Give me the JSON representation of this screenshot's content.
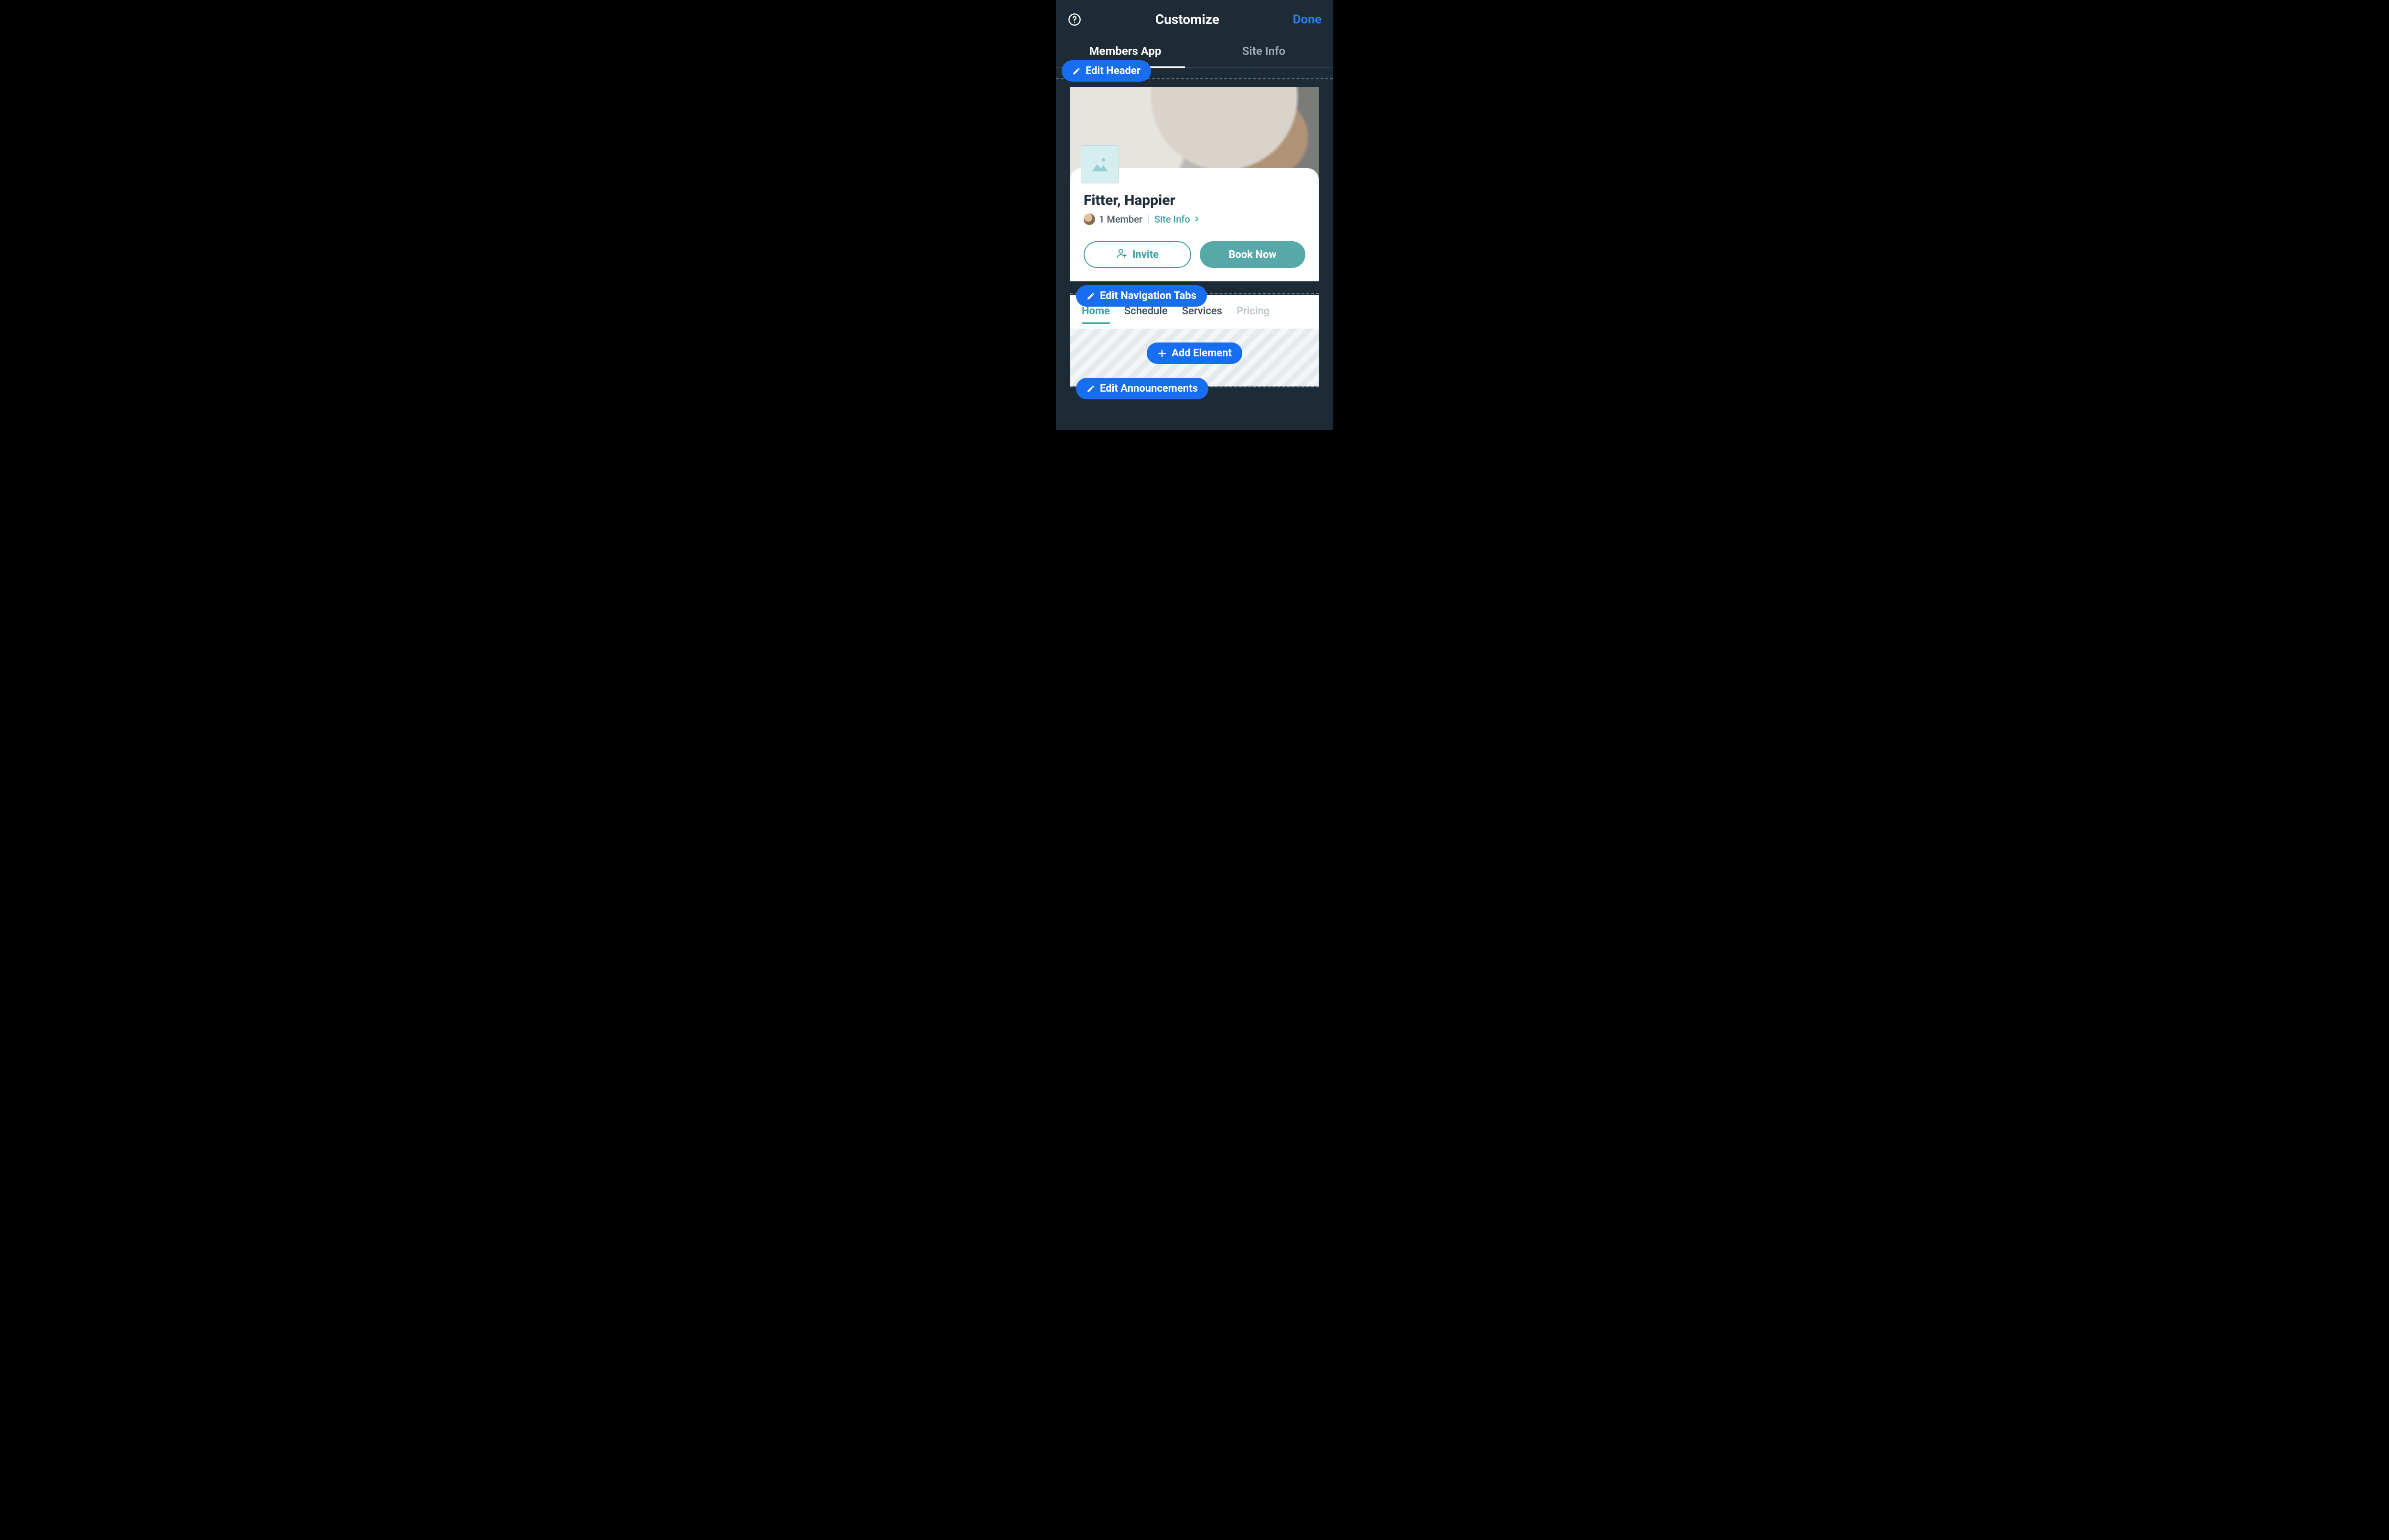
{
  "topbar": {
    "title": "Customize",
    "done": "Done"
  },
  "segmentTabs": {
    "members": "Members App",
    "siteinfo": "Site Info"
  },
  "pills": {
    "editHeader": "Edit Header",
    "editNav": "Edit Navigation Tabs",
    "addElement": "Add Element",
    "editAnnouncements": "Edit Announcements"
  },
  "site": {
    "title": "Fitter, Happier",
    "memberCount": "1 Member",
    "siteInfoLink": "Site Info",
    "inviteLabel": "Invite",
    "bookNowLabel": "Book Now"
  },
  "navTabs": [
    "Home",
    "Schedule",
    "Services",
    "Pricing"
  ],
  "colors": {
    "accentBlue": "#2e7ff1",
    "pillBlue": "#186ef0",
    "teal": "#48a9a6"
  }
}
